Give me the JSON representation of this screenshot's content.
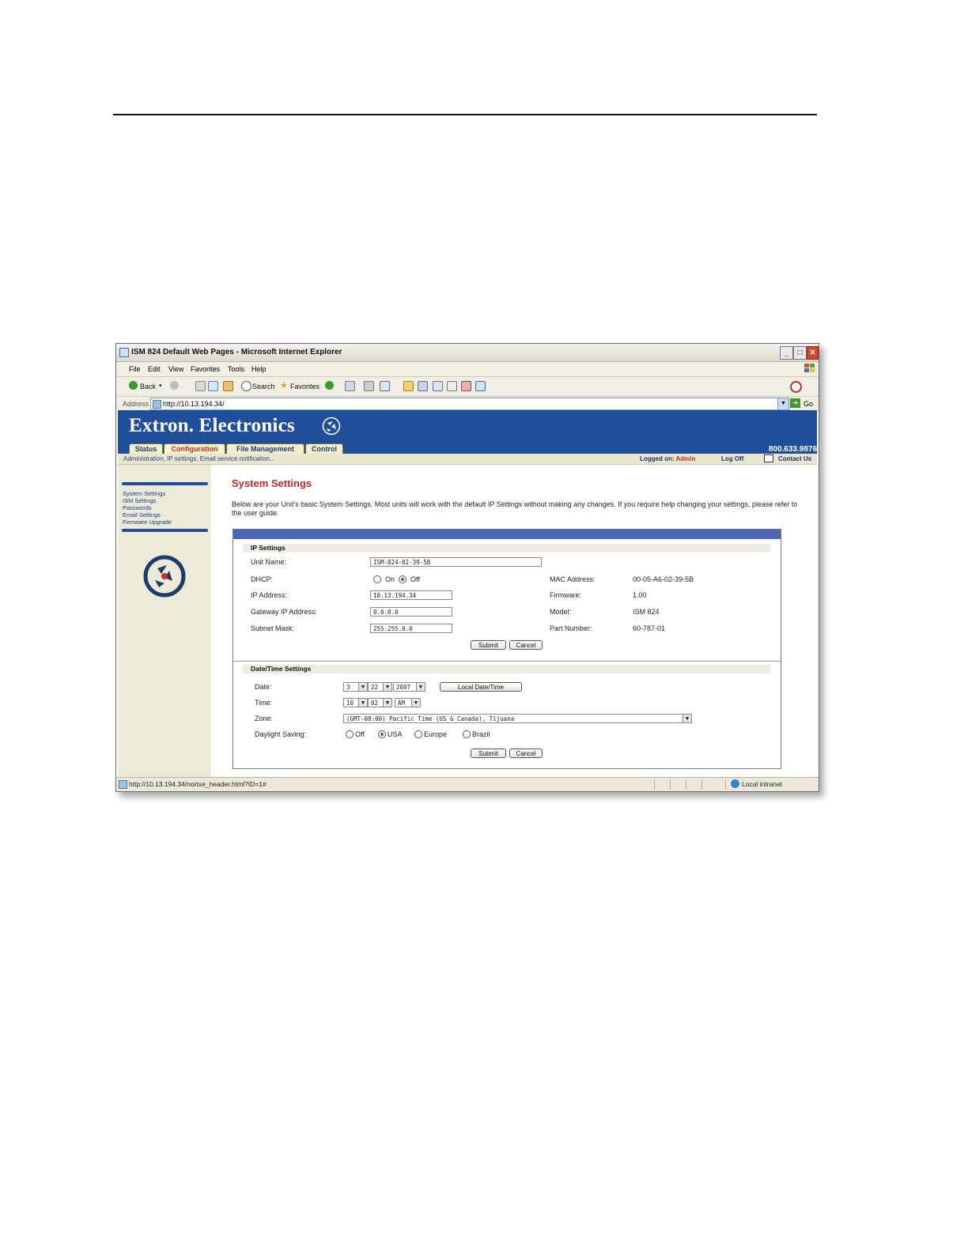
{
  "window": {
    "title": "ISM 824 Default Web Pages - Microsoft Internet Explorer"
  },
  "menu": [
    "File",
    "Edit",
    "View",
    "Favorites",
    "Tools",
    "Help"
  ],
  "toolbar": {
    "back": "Back",
    "search": "Search",
    "favorites": "Favorites"
  },
  "address": {
    "label": "Address",
    "url": "http://10.13.194.34/",
    "go": "Go"
  },
  "header": {
    "brand": "Extron. Electronics",
    "phone": "800.633.9876",
    "tabs": [
      "Status",
      "Configuration",
      "File Management",
      "Control"
    ],
    "active_tab": "Configuration",
    "breadcrumb": "Administration, IP settings, Email service notification...",
    "logged_on_label": "Logged on:",
    "logged_on_user": "Admin",
    "log_off": "Log Off",
    "contact": "Contact Us"
  },
  "sidebar": {
    "links": [
      "System Settings",
      "ISM Settings",
      "Passwords",
      "Email Settings",
      "Firmware Upgrade"
    ]
  },
  "main": {
    "title": "System Settings",
    "intro": "Below are your Unit's basic System Settings. Most units will work with the default IP Settings without making any changes. If you require help changing your settings, please refer to the user guide."
  },
  "ip": {
    "heading": "IP Settings",
    "unit_name_label": "Unit Name:",
    "unit_name": "ISM-824-02-39-5B",
    "dhcp_label": "DHCP:",
    "dhcp_on": "On",
    "dhcp_off": "Off",
    "ip_label": "IP Address:",
    "ip": "10.13.194.34",
    "gateway_label": "Gateway IP Address:",
    "gateway": "0.0.0.0",
    "subnet_label": "Subnet Mask:",
    "subnet": "255.255.0.0",
    "mac_label": "MAC Address:",
    "mac": "00-05-A6-02-39-5B",
    "firmware_label": "Firmware:",
    "firmware": "1.00",
    "model_label": "Model:",
    "model": "ISM 824",
    "part_label": "Part Number:",
    "part": "60-787-01",
    "submit": "Submit",
    "cancel": "Cancel"
  },
  "datetime": {
    "heading": "Date/Time Settings",
    "date_label": "Date:",
    "month": "3",
    "day": "22",
    "year": "2007",
    "local_btn": "Local Date/Time",
    "time_label": "Time:",
    "hour": "10",
    "minute": "02",
    "ampm": "AM",
    "zone_label": "Zone:",
    "zone": "(GMT-08:00) Pacific Time (US & Canada), Tijuana",
    "dst_label": "Daylight Saving:",
    "dst_options": [
      "Off",
      "USA",
      "Europe",
      "Brazil"
    ],
    "dst_selected": "USA",
    "submit": "Submit",
    "cancel": "Cancel"
  },
  "status": {
    "url": "http://10.13.194.34/nortxe_header.html?ID=1#",
    "zone": "Local intranet"
  },
  "colors": {
    "header_blue": "#1f4e9b",
    "accent_red": "#c8261a"
  }
}
